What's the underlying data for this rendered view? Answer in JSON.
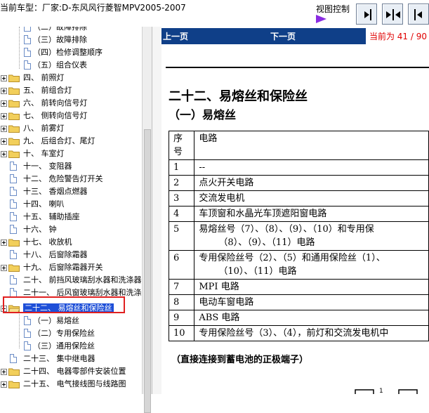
{
  "header": {
    "car_label": "当前车型：厂家:D-东风风行菱智MPV2005-2007",
    "view_control_label": "视图控制",
    "buttons": [
      "view-btn-1-icon",
      "view-btn-2-icon",
      "view-btn-3-icon"
    ]
  },
  "tree": {
    "items": [
      {
        "label": "（二）故障排除",
        "level": 2,
        "type": "doc"
      },
      {
        "label": "（三）故障排除",
        "level": 2,
        "type": "doc"
      },
      {
        "label": "（四）检修调整顺序",
        "level": 2,
        "type": "doc"
      },
      {
        "label": "（五）组合仪表",
        "level": 2,
        "type": "doc"
      },
      {
        "label": "四、 前照灯",
        "level": 1,
        "type": "folder"
      },
      {
        "label": "五、 前组合灯",
        "level": 1,
        "type": "folder"
      },
      {
        "label": "六、 前转向信号灯",
        "level": 1,
        "type": "folder"
      },
      {
        "label": "七、 侧转向信号灯",
        "level": 1,
        "type": "folder"
      },
      {
        "label": "八、 前雾灯",
        "level": 1,
        "type": "folder"
      },
      {
        "label": "九、 后组合灯、尾灯",
        "level": 1,
        "type": "folder"
      },
      {
        "label": "十、 车室灯",
        "level": 1,
        "type": "folder"
      },
      {
        "label": "十一、 变阻器",
        "level": 1,
        "type": "doc"
      },
      {
        "label": "十二、 危险警告灯开关",
        "level": 1,
        "type": "doc"
      },
      {
        "label": "十三、 香烟点燃器",
        "level": 1,
        "type": "doc"
      },
      {
        "label": "十四、 喇叭",
        "level": 1,
        "type": "doc"
      },
      {
        "label": "十五、 辅助插座",
        "level": 1,
        "type": "doc"
      },
      {
        "label": "十六、 钟",
        "level": 1,
        "type": "doc"
      },
      {
        "label": "十七、 收放机",
        "level": 1,
        "type": "folder"
      },
      {
        "label": "十八、 后窗除霜器",
        "level": 1,
        "type": "doc"
      },
      {
        "label": "十九、 后窗除霜器开关",
        "level": 1,
        "type": "folder"
      },
      {
        "label": "二十、 前挡风玻璃刮水器和洗涤器",
        "level": 1,
        "type": "doc"
      },
      {
        "label": "二十一、 后风窗玻璃刮水器和洗涤",
        "level": 1,
        "type": "doc"
      },
      {
        "label": "二十二、 易熔丝和保险丝",
        "level": 1,
        "type": "folder-open",
        "selected": true
      },
      {
        "label": "（一）易熔丝",
        "level": 2,
        "type": "doc"
      },
      {
        "label": "（二）专用保险丝",
        "level": 2,
        "type": "doc"
      },
      {
        "label": "（三）通用保险丝",
        "level": 2,
        "type": "doc"
      },
      {
        "label": "二十三、 集中继电器",
        "level": 1,
        "type": "doc"
      },
      {
        "label": "二十四、 电器零部件安装位置",
        "level": 1,
        "type": "folder"
      },
      {
        "label": "二十五、 电气接线图与线路图",
        "level": 1,
        "type": "folder"
      }
    ]
  },
  "nav": {
    "prev_label": "上一页",
    "next_label": "下一页",
    "position_label": "当前为 41 / 90"
  },
  "document": {
    "title": "二十二、易熔丝和保险丝",
    "subtitle": "（一）易熔丝",
    "table_header": {
      "no": "序号",
      "circuit": "电路"
    },
    "table_rows": [
      {
        "no": "1",
        "circuit": "--"
      },
      {
        "no": "2",
        "circuit": "点火开关电路"
      },
      {
        "no": "3",
        "circuit": "交流发电机"
      },
      {
        "no": "4",
        "circuit": "车顶窗和水晶光车顶遮阳窗电路"
      },
      {
        "no": "5",
        "circuit": "易熔丝号（7）、（8）、（9）、（10）和专用保",
        "circuit2": "（8）、（9）、（11）电路"
      },
      {
        "no": "6",
        "circuit": "专用保险丝号（2）、（5）和通用保险丝（1）、",
        "circuit2": "（10）、（11）电路"
      },
      {
        "no": "7",
        "circuit": "MPI 电路"
      },
      {
        "no": "8",
        "circuit": "电动车窗电路"
      },
      {
        "no": "9",
        "circuit": "ABS 电路"
      },
      {
        "no": "10",
        "circuit": "专用保险丝号（3）、（4），前灯和交流发电机中"
      }
    ],
    "note": "（直接连接到蓄电池的正极端子）",
    "figure_label": "1"
  },
  "colors": {
    "nav_bar": "#0f3f88",
    "position_text": "#e00000",
    "selection": "#1e4fd8",
    "highlight_box": "#e02020",
    "play_triangle": "#8a2be2"
  }
}
